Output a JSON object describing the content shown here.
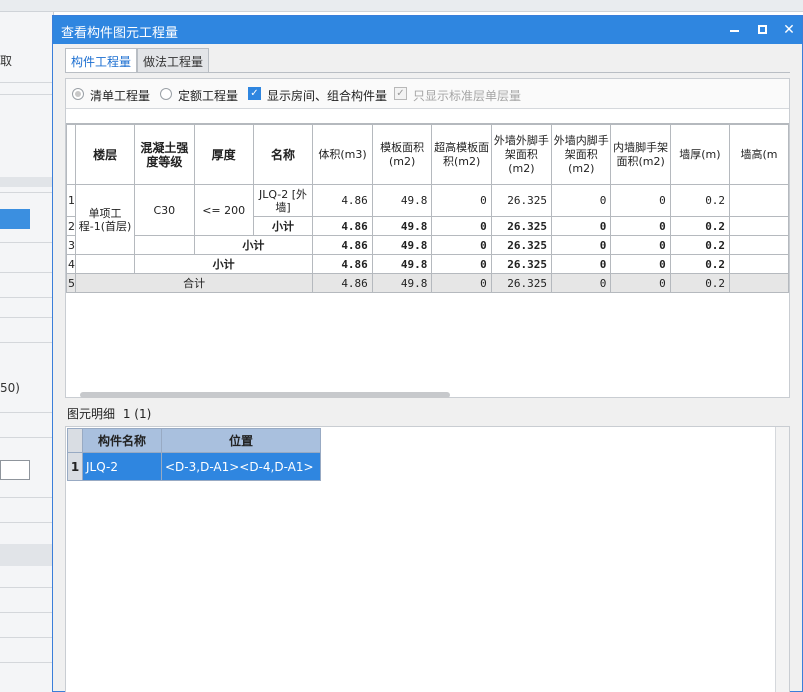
{
  "background": {
    "labels": [
      "取",
      "50)"
    ]
  },
  "dialog": {
    "title": "查看构件图元工程量",
    "minimize": "",
    "maximize": "",
    "close": "✕"
  },
  "tabs": [
    {
      "label": "构件工程量",
      "active": true
    },
    {
      "label": "做法工程量",
      "active": false
    }
  ],
  "options": {
    "bill_qty": "清单工程量",
    "quota_qty": "定额工程量",
    "show_rooms": "显示房间、组合构件量",
    "std_floor_only": "只显示标准层单层量"
  },
  "qty_table": {
    "headers": [
      "楼层",
      "混凝土强度等级",
      "厚度",
      "名称",
      "体积(m3)",
      "模板面积(m2)",
      "超高模板面积(m2)",
      "外墙外脚手架面积(m2)",
      "外墙内脚手架面积(m2)",
      "内墙脚手架面积(m2)",
      "墙厚(m)",
      "墙高(m"
    ],
    "row_numbers": [
      "1",
      "2",
      "3",
      "4",
      "5"
    ],
    "floor": "单项工程-1(首层)",
    "grade": "C30",
    "thickness": "<= 200",
    "name": "JLQ-2 [外墙]",
    "subtotal": "小计",
    "total": "合计",
    "values": [
      "4.86",
      "49.8",
      "0",
      "26.325",
      "0",
      "0",
      "0.2"
    ]
  },
  "detail": {
    "label": "图元明细",
    "count": "1 (1)",
    "headers": [
      "构件名称",
      "位置"
    ],
    "rows": [
      {
        "no": "1",
        "name": "JLQ-2",
        "position": "<D-3,D-A1><D-4,D-A1>"
      }
    ]
  }
}
